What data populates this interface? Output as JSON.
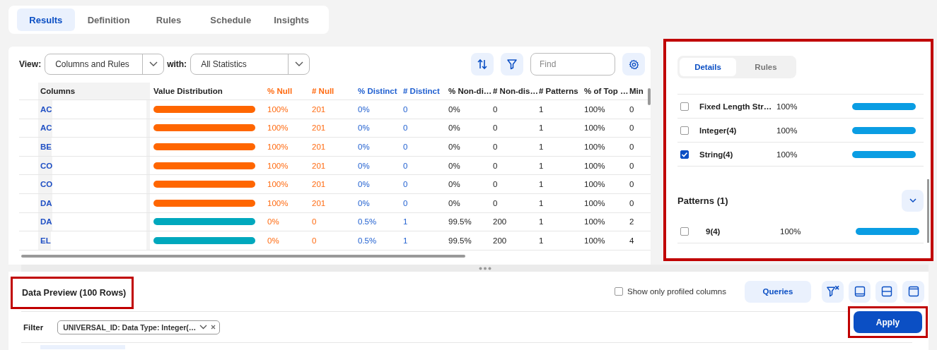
{
  "tabs": [
    {
      "label": "Results",
      "selected": true
    },
    {
      "label": "Definition",
      "selected": false
    },
    {
      "label": "Rules",
      "selected": false
    },
    {
      "label": "Schedule",
      "selected": false
    },
    {
      "label": "Insights",
      "selected": false
    }
  ],
  "toolbar": {
    "view_label": "View:",
    "view_value": "Columns and Rules",
    "with_label": "with:",
    "with_value": "All Statistics",
    "find_placeholder": "Find"
  },
  "table": {
    "columns": [
      {
        "label": "Columns",
        "kind": "name"
      },
      {
        "label": "Value Distribution",
        "kind": "bar"
      },
      {
        "label": "% Null",
        "kind": "null"
      },
      {
        "label": "# Null",
        "kind": "null"
      },
      {
        "label": "% Distinct",
        "kind": "distinct"
      },
      {
        "label": "# Distinct",
        "kind": "distinct"
      },
      {
        "label": "% Non-di…",
        "kind": "plain"
      },
      {
        "label": "# Non-dis…",
        "kind": "plain"
      },
      {
        "label": "# Patterns",
        "kind": "plain"
      },
      {
        "label": "% of Top …",
        "kind": "plain"
      },
      {
        "label": "Min",
        "kind": "plain"
      }
    ],
    "rows": [
      {
        "name": "AC",
        "color": "#ff6600",
        "values": [
          "100%",
          "201",
          "0%",
          "0",
          "0%",
          "0",
          "1",
          "100%",
          "0"
        ]
      },
      {
        "name": "AC",
        "color": "#ff6600",
        "values": [
          "100%",
          "201",
          "0%",
          "0",
          "0%",
          "0",
          "1",
          "100%",
          "0"
        ]
      },
      {
        "name": "BE",
        "color": "#ff6600",
        "values": [
          "100%",
          "201",
          "0%",
          "0",
          "0%",
          "0",
          "1",
          "100%",
          "0"
        ]
      },
      {
        "name": "CO",
        "color": "#ff6600",
        "values": [
          "100%",
          "201",
          "0%",
          "0",
          "0%",
          "0",
          "1",
          "100%",
          "0"
        ]
      },
      {
        "name": "CO",
        "color": "#ff6600",
        "values": [
          "100%",
          "201",
          "0%",
          "0",
          "0%",
          "0",
          "1",
          "100%",
          "0"
        ]
      },
      {
        "name": "DA",
        "color": "#ff6600",
        "values": [
          "100%",
          "201",
          "0%",
          "0",
          "0%",
          "0",
          "1",
          "100%",
          "0"
        ]
      },
      {
        "name": "DA",
        "color": "#00a8bd",
        "values": [
          "0%",
          "0",
          "0.5%",
          "1",
          "99.5%",
          "200",
          "1",
          "100%",
          "2"
        ]
      },
      {
        "name": "EL",
        "color": "#00a8bd",
        "values": [
          "0%",
          "0",
          "0.5%",
          "1",
          "99.5%",
          "200",
          "1",
          "100%",
          "4"
        ]
      }
    ]
  },
  "details_panel": {
    "tabs": [
      {
        "label": "Details",
        "selected": true
      },
      {
        "label": "Rules",
        "selected": false
      }
    ],
    "data_types": [
      {
        "label": "Fixed Length Str…",
        "percent": "100%",
        "checked": false
      },
      {
        "label": "Integer(4)",
        "percent": "100%",
        "checked": false
      },
      {
        "label": "String(4)",
        "percent": "100%",
        "checked": true
      }
    ],
    "patterns": {
      "title": "Patterns (1)",
      "items": [
        {
          "label": "9(4)",
          "percent": "100%",
          "checked": false
        }
      ]
    }
  },
  "data_preview": {
    "title": "Data Preview (100 Rows)",
    "profiled_only": {
      "label": "Show only profiled columns",
      "checked": false
    },
    "queries_button": "Queries",
    "filter_label": "Filter",
    "filter_chip": "UNIVERSAL_ID: Data Type: Integer(…",
    "apply_button": "Apply"
  }
}
